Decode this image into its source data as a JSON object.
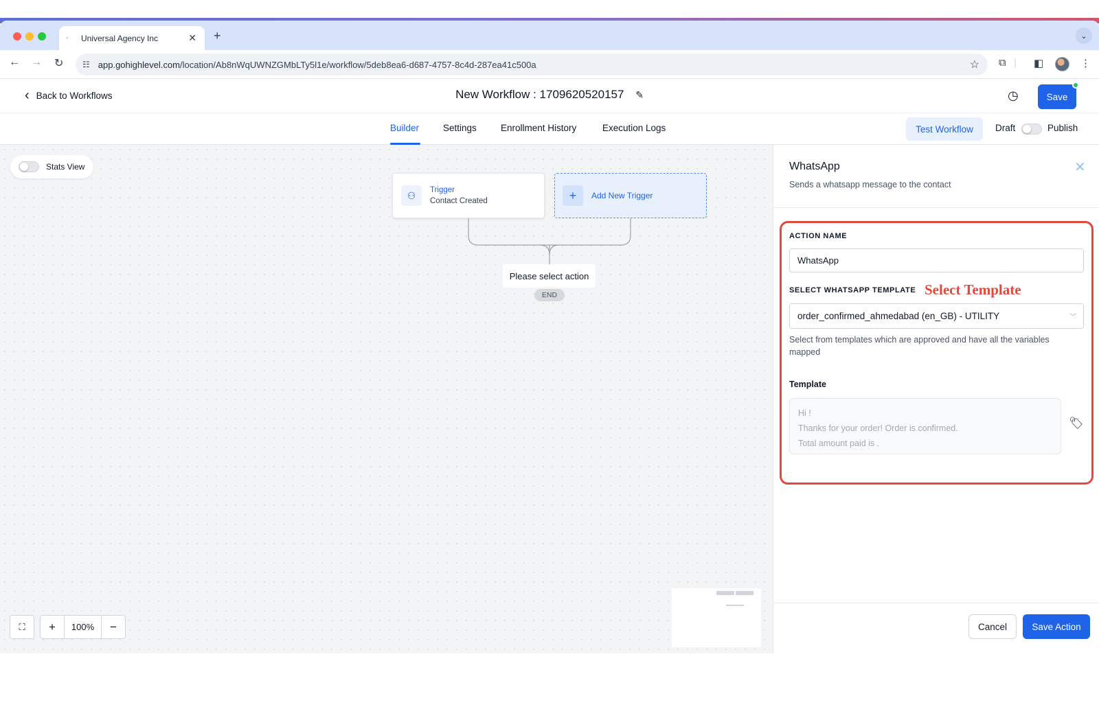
{
  "colors": {
    "accent": "#1e63e8",
    "highlight": "#e04a3c",
    "status_dot": "#22c55e"
  },
  "browser": {
    "tab_title": "Universal Agency Inc",
    "url_host": "app.gohighlevel.com",
    "url_path": "/location/Ab8nWqUWNZGMbLTy5l1e/workflow/5deb8ea6-d687-4757-8c4d-287ea41c500a"
  },
  "header": {
    "back_label": "Back to Workflows",
    "title": "New Workflow : 1709620520157",
    "save_label": "Save"
  },
  "subnav": {
    "tabs": [
      {
        "label": "Builder",
        "active": true
      },
      {
        "label": "Settings"
      },
      {
        "label": "Enrollment History"
      },
      {
        "label": "Execution Logs"
      }
    ],
    "test_label": "Test Workflow",
    "draft_label": "Draft",
    "publish_label": "Publish"
  },
  "canvas": {
    "stats_label": "Stats View",
    "trigger": {
      "title": "Trigger",
      "subtitle": "Contact Created"
    },
    "add_trigger_label": "Add New Trigger",
    "select_action_label": "Please select action",
    "end_label": "END",
    "zoom_level": "100%"
  },
  "panel": {
    "title": "WhatsApp",
    "subtitle": "Sends a whatsapp message to the contact",
    "action_name_label": "ACTION NAME",
    "action_name_value": "WhatsApp",
    "template_select_label": "SELECT WHATSAPP TEMPLATE",
    "callout": "Select Template",
    "template_select_value": "order_confirmed_ahmedabad (en_GB) - UTILITY",
    "help_text": "Select from templates which are approved and have all the variables mapped",
    "template_label": "Template",
    "template_lines": [
      "Hi !",
      "Thanks for your order! Order   is confirmed.",
      "Total amount paid is  ."
    ],
    "cancel_label": "Cancel",
    "save_action_label": "Save Action"
  }
}
